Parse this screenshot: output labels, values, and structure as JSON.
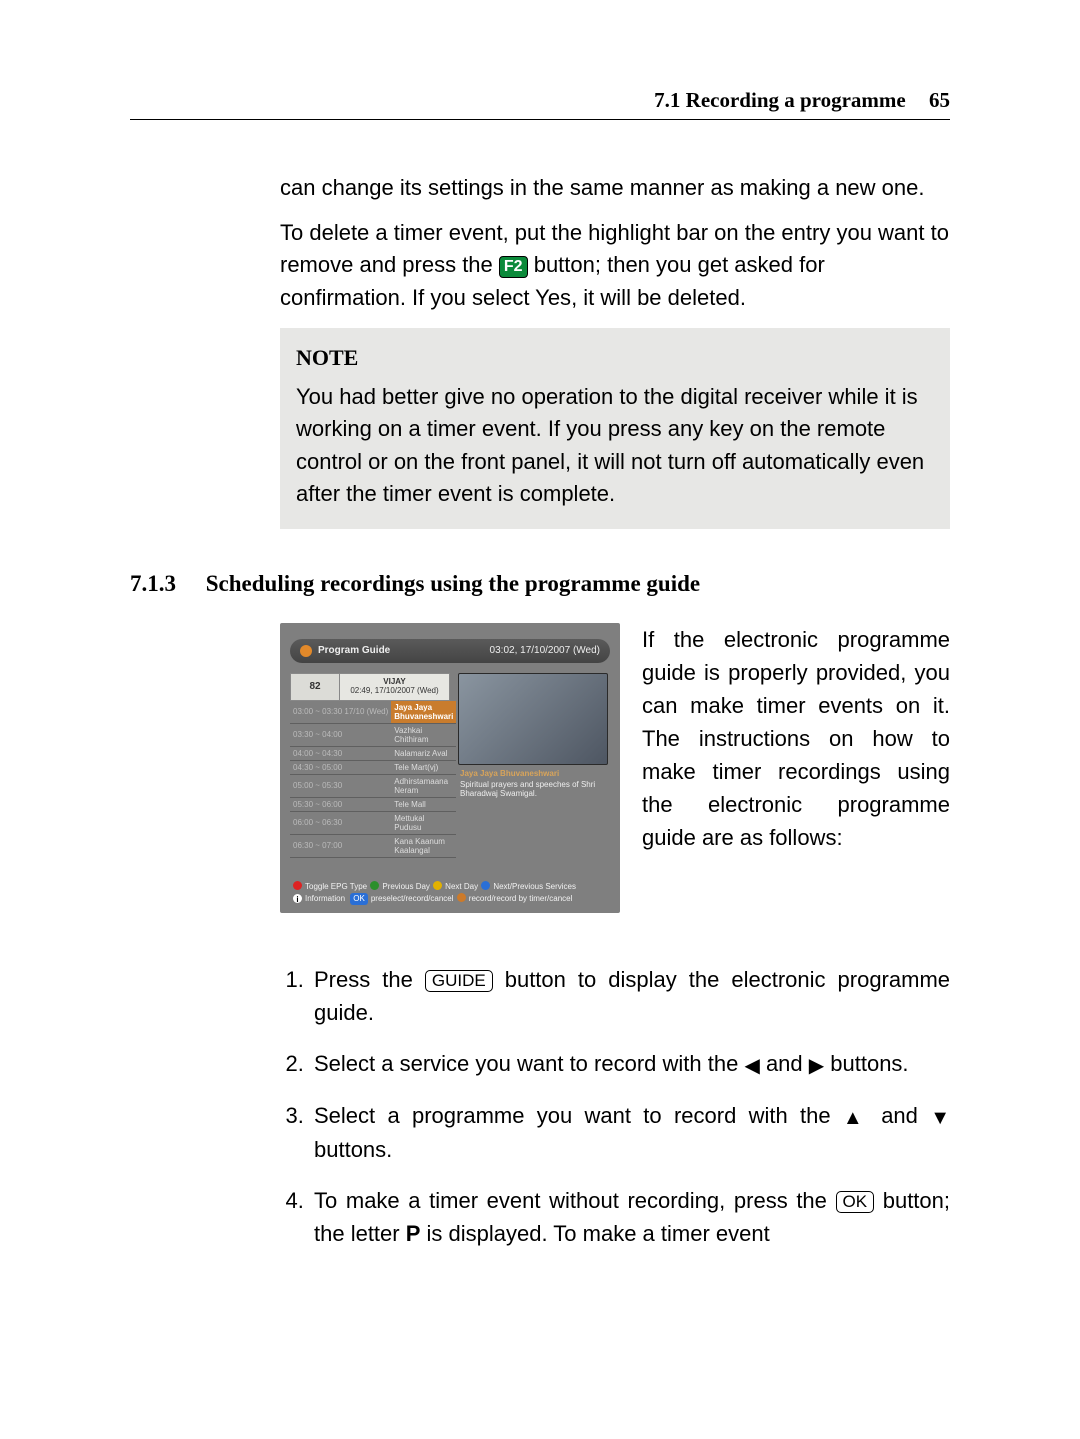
{
  "header": {
    "section": "7.1 Recording a programme",
    "page": "65"
  },
  "para1": "can change its settings in the same manner as making a new one.",
  "para2a": "To delete a timer event, put the highlight bar on the entry you want to remove and press the ",
  "f2": "F2",
  "para2b": " button; then you get asked for conﬁrmation. If you select ",
  "yes": "Yes",
  "para2c": ", it will be deleted.",
  "note": {
    "title": "NOTE",
    "body": "You had better give no operation to the digital receiver while it is working on a timer event. If you press any key on the remote control or on the front panel, it will not turn off automatically even after the timer event is complete."
  },
  "subsec": {
    "num": "7.1.3",
    "title": "Scheduling recordings using the programme guide"
  },
  "epg": {
    "title": "Program Guide",
    "clock": "03:02, 17/10/2007 (Wed)",
    "chno": "82",
    "chname": "VIJAY",
    "chtime": "02:49, 17/10/2007 (Wed)",
    "rows": [
      {
        "t": "03:00 ~ 03:30 17/10 (Wed)",
        "n": "Jaya Jaya Bhuvaneshwari",
        "sel": true
      },
      {
        "t": "03:30 ~ 04:00",
        "n": "Vazhkai Chithiram"
      },
      {
        "t": "04:00 ~ 04:30",
        "n": "Nalamariz Aval"
      },
      {
        "t": "04:30 ~ 05:00",
        "n": "Tele Mart(vj)"
      },
      {
        "t": "05:00 ~ 05:30",
        "n": "Adhirstamaana Neram"
      },
      {
        "t": "05:30 ~ 06:00",
        "n": "Tele Mall"
      },
      {
        "t": "06:00 ~ 06:30",
        "n": "Mettukal Pudusu"
      },
      {
        "t": "06:30 ~ 07:00",
        "n": "Kana Kaanum Kaalangal"
      }
    ],
    "desc_title": "Jaya Jaya Bhuvaneshwari",
    "desc_body": "Spiritual prayers and speeches of Shri Bharadwaj Swamigal.",
    "legend1a": "Toggle EPG Type",
    "legend1b": "Previous Day",
    "legend1c": "Next Day",
    "legend1d": "Next/Previous Services",
    "legend2a": "Information",
    "legend2b": "preselect/record/cancel",
    "legend2c": "record/record by timer/cancel",
    "ok": "OK"
  },
  "ftext": "If the electronic programme guide is properly provided, you can make timer events on it. The instructions on how to make timer recordings using the electronic programme guide are as follows:",
  "steps": {
    "s1a": "Press the ",
    "guide": "GUIDE",
    "s1b": " button to display the electronic programme guide.",
    "s2a": "Select a service you want to record with the ",
    "s2b": " and ",
    "s2c": " buttons.",
    "s3a": "Select a programme you want to record with the ",
    "s3b": " and ",
    "s3c": " buttons.",
    "s4a": "To make a timer event without recording, press the ",
    "ok": "OK",
    "s4b": " button; the letter ",
    "p": "P",
    "s4c": " is displayed. To make a timer event"
  },
  "icons": {
    "left": "◀",
    "right": "▶",
    "up": "▲",
    "down": "▼"
  }
}
